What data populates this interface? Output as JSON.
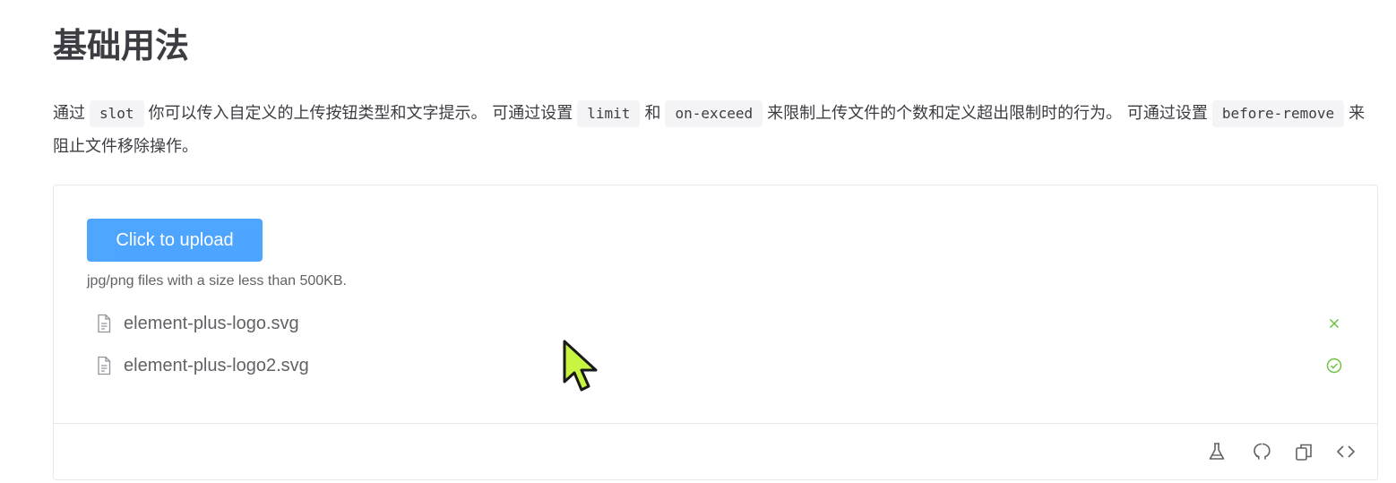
{
  "page": {
    "title": "基础用法"
  },
  "description": {
    "part1": "通过",
    "code_slot": "slot",
    "part2": "你可以传入自定义的上传按钮类型和文字提示。 可通过设置",
    "code_limit": "limit",
    "part3": "和",
    "code_on_exceed": "on-exceed",
    "part4": "来限制上传文件的个数和定义超出限制时的行为。 可通过设置",
    "code_before_remove": "before-remove",
    "part5": "来阻止文件移除操作。"
  },
  "demo": {
    "upload_button_label": "Click to upload",
    "tip": "jpg/png files with a size less than 500KB.",
    "files": [
      {
        "name": "element-plus-logo.svg",
        "status_icon": "close-icon"
      },
      {
        "name": "element-plus-logo2.svg",
        "status_icon": "success-check-icon"
      }
    ]
  },
  "toolbar": {
    "icons": [
      "playground-flask-icon",
      "github-icon",
      "copy-icon",
      "view-source-icon"
    ]
  },
  "colors": {
    "primary": "#409eff",
    "success": "#67c23a",
    "cursor": "#c8f542"
  }
}
